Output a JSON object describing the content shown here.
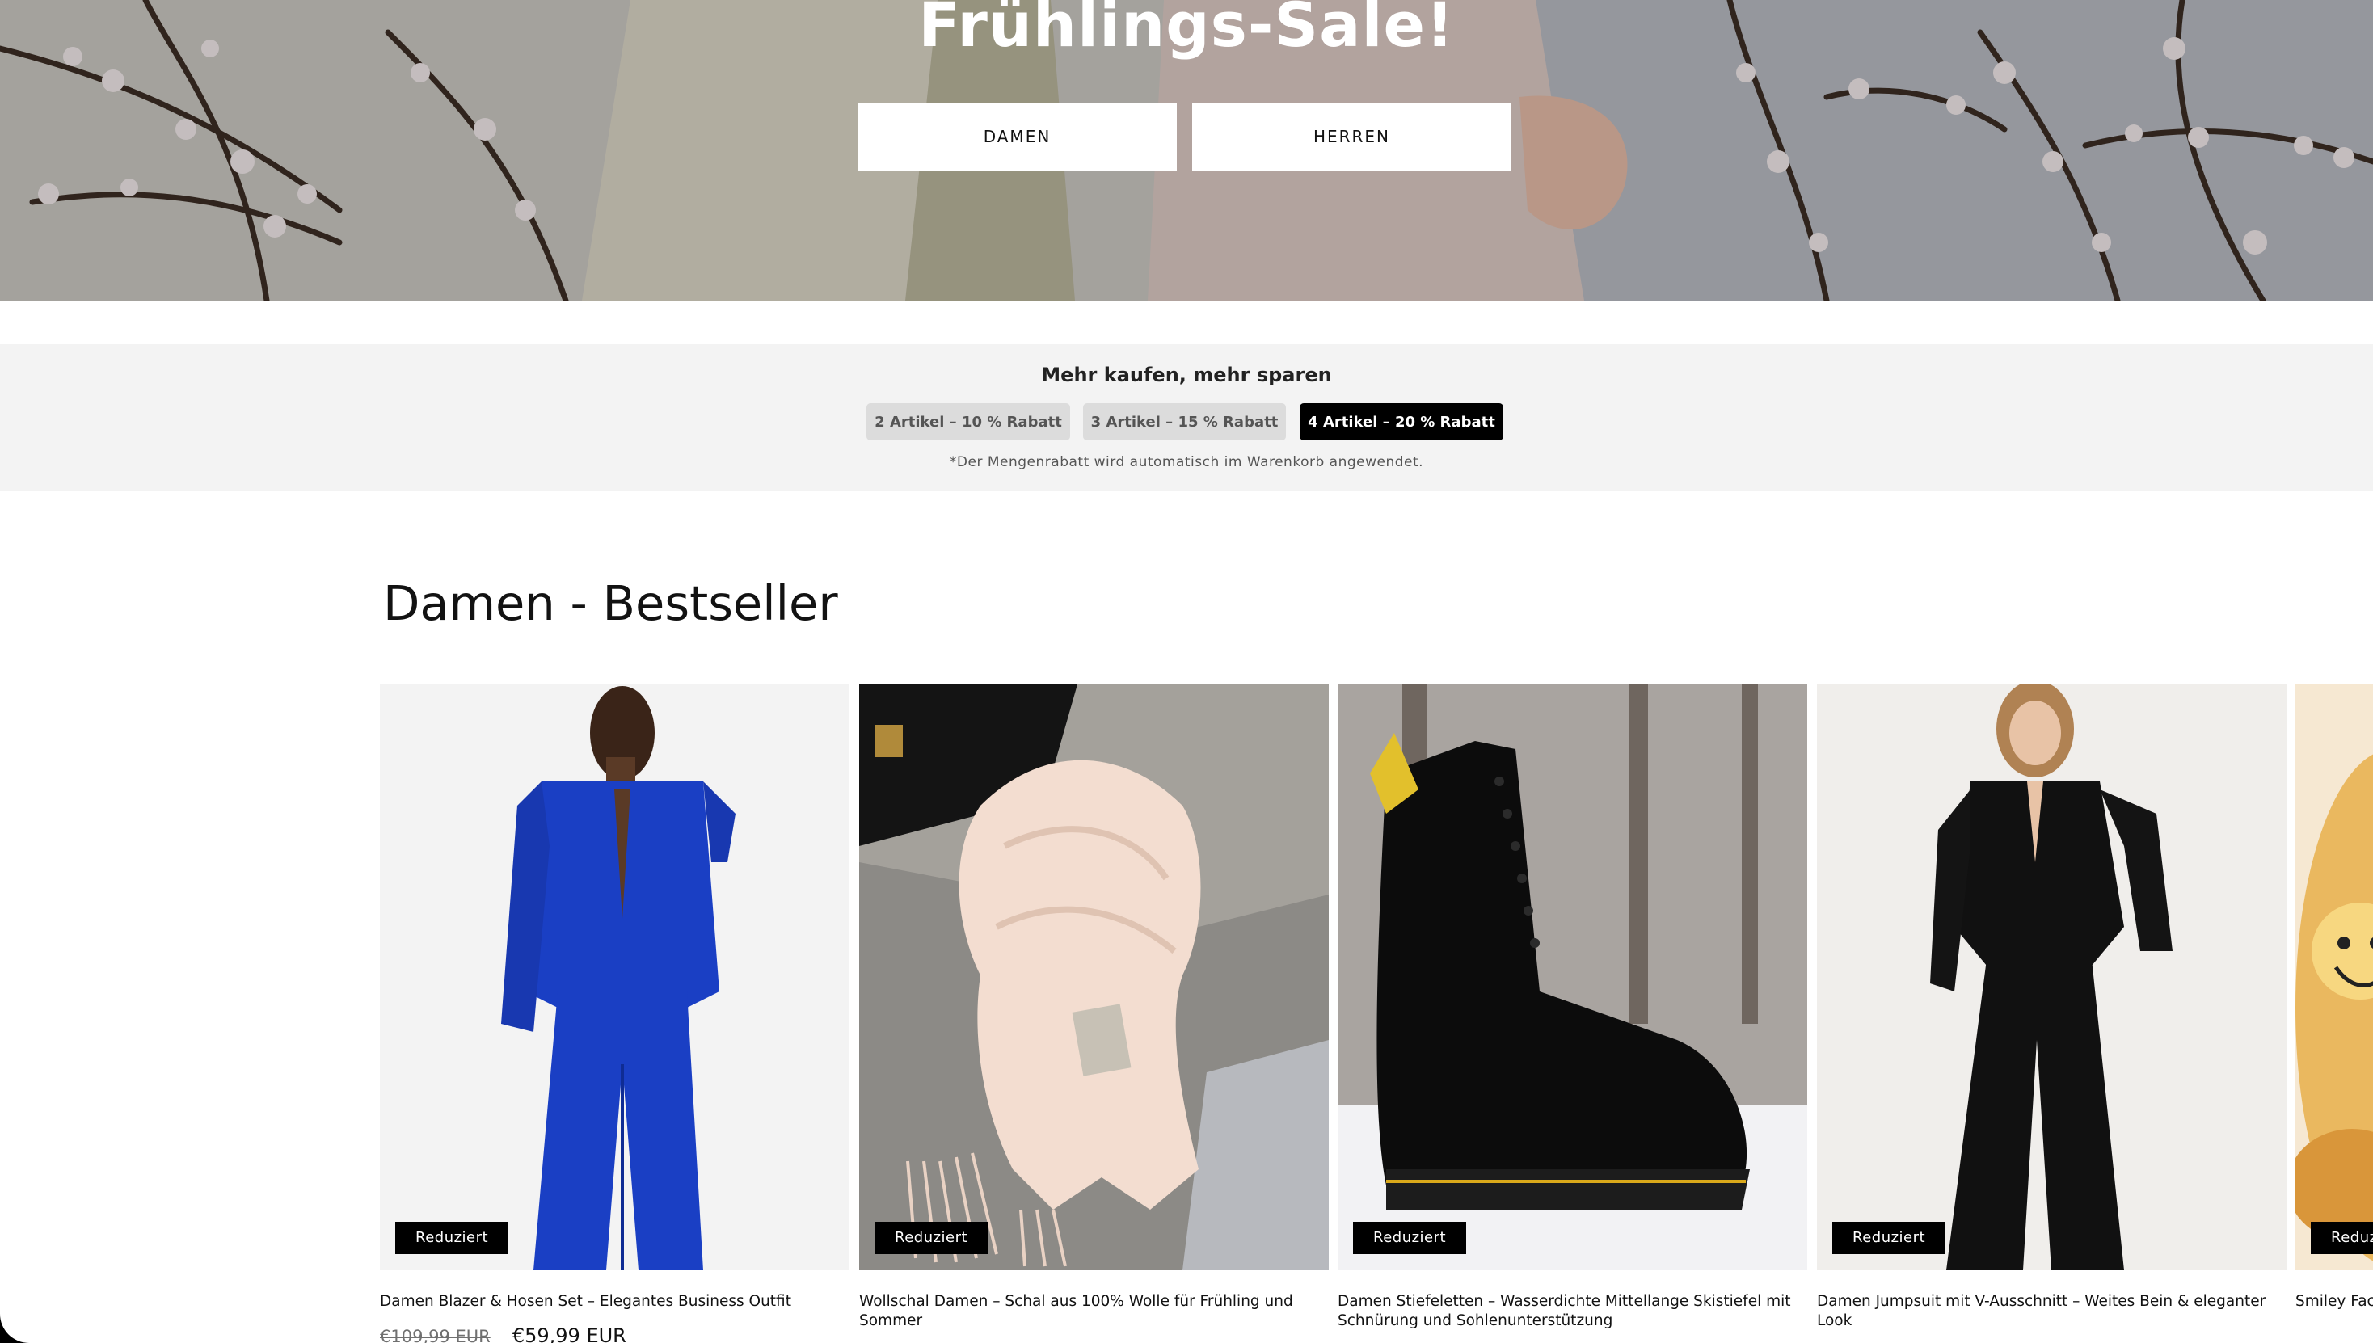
{
  "hero": {
    "title": "Frühlings-Sale!",
    "buttons": [
      "DAMEN",
      "HERREN"
    ]
  },
  "volume_discount": {
    "title": "Mehr kaufen, mehr sparen",
    "tiers": [
      {
        "label": "2 Artikel – 10 % Rabatt",
        "selected": false
      },
      {
        "label": "3 Artikel – 15 % Rabatt",
        "selected": false
      },
      {
        "label": "4 Artikel – 20 % Rabatt",
        "selected": true
      }
    ],
    "note": "*Der Mengenrabatt wird automatisch im Warenkorb angewendet."
  },
  "section": {
    "title": "Damen - Bestseller",
    "products": [
      {
        "title": "Damen Blazer & Hosen Set – Elegantes Business Outfit",
        "badge": "Reduziert",
        "old_price": "€109,99 EUR",
        "price": "€59,99 EUR"
      },
      {
        "title": "Wollschal Damen – Schal aus 100% Wolle für Frühling und Sommer",
        "badge": "Reduziert"
      },
      {
        "title": "Damen Stiefeletten – Wasserdichte Mittellange Skistiefel mit Schnürung und Sohlenunterstützung",
        "badge": "Reduziert"
      },
      {
        "title": "Damen Jumpsuit mit V-Ausschnitt – Weites Bein & eleganter Look",
        "badge": "Reduziert"
      },
      {
        "title": "Smiley Face Innenfutter",
        "badge": "Reduziert"
      }
    ]
  },
  "colors": {
    "accent_black": "#000000",
    "tier_inactive": "#dcdcdc",
    "panel_bg": "#f3f3f3",
    "suit_blue": "#1a3fc4"
  }
}
